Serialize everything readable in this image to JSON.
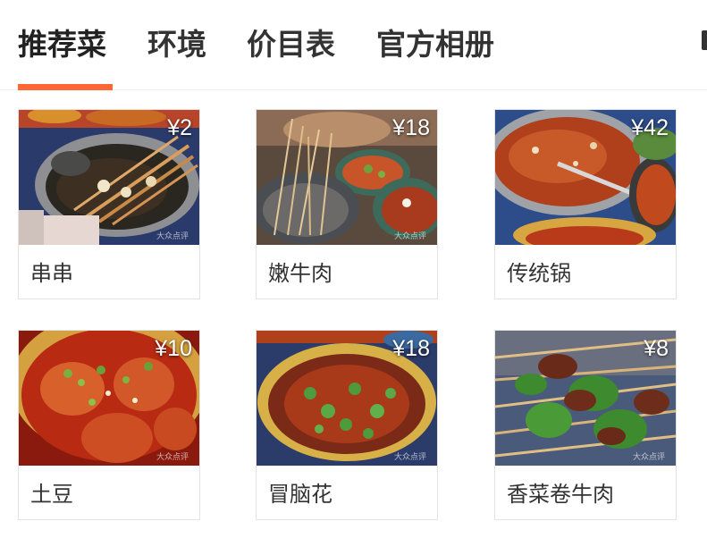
{
  "tabs": [
    {
      "label": "推荐菜",
      "active": true
    },
    {
      "label": "环境",
      "active": false
    },
    {
      "label": "价目表",
      "active": false
    },
    {
      "label": "官方相册",
      "active": false
    }
  ],
  "accent_color": "#ff6633",
  "dishes": [
    {
      "name": "串串",
      "price": "¥2"
    },
    {
      "name": "嫩牛肉",
      "price": "¥18"
    },
    {
      "name": "传统锅",
      "price": "¥42"
    },
    {
      "name": "土豆",
      "price": "¥10"
    },
    {
      "name": "冒脑花",
      "price": "¥18"
    },
    {
      "name": "香菜卷牛肉",
      "price": "¥8"
    }
  ],
  "watermark": "大众点评"
}
